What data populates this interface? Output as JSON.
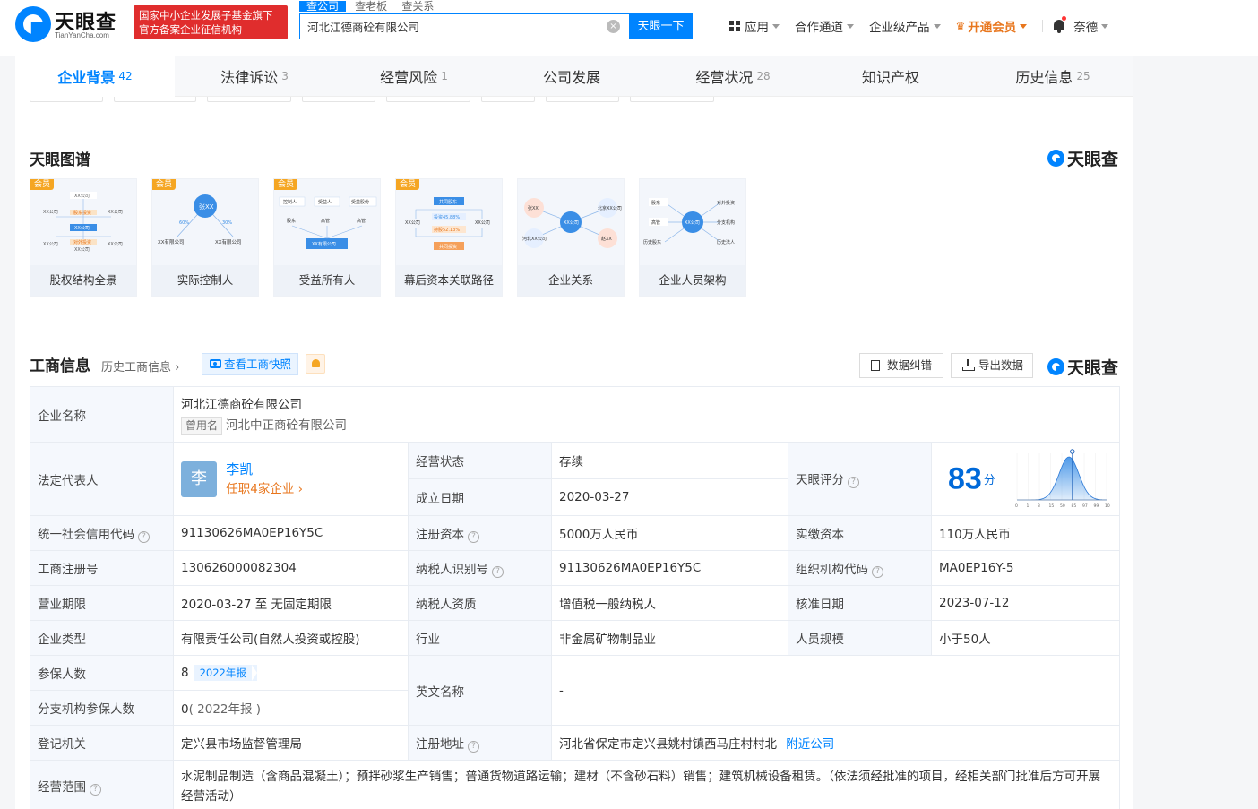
{
  "header": {
    "logo_text": "天眼查",
    "logo_sub": "TianYanCha.com",
    "gov_line1": "国家中小企业发展子基金旗下",
    "gov_line2": "官方备案企业征信机构",
    "search_tabs": [
      "查公司",
      "查老板",
      "查关系"
    ],
    "search_value": "河北江德商砼有限公司",
    "search_button": "天眼一下",
    "nav": {
      "apps": "应用",
      "partners": "合作通道",
      "enterprise": "企业级产品",
      "vip": "开通会员",
      "user": "奈德"
    }
  },
  "tabs": [
    {
      "label": "企业背景",
      "count": "42"
    },
    {
      "label": "法律诉讼",
      "count": "3"
    },
    {
      "label": "经营风险",
      "count": "1"
    },
    {
      "label": "公司发展",
      "count": ""
    },
    {
      "label": "经营状况",
      "count": "28"
    },
    {
      "label": "知识产权",
      "count": ""
    },
    {
      "label": "历史信息",
      "count": "25"
    }
  ],
  "graph_section": {
    "title": "天眼图谱",
    "brand": "天眼查",
    "vip_tag": "会员",
    "cards": [
      {
        "name": "股权结构全景",
        "vip": true,
        "thumb": {
          "t1": "XX公司",
          "t2": "XX公司",
          "t3": "XX公司",
          "t4": "XX公司",
          "t5": "XX公司",
          "t6": "XX公司",
          "t7": "XX公司",
          "e1": "对外投资",
          "e2": "股东投资"
        }
      },
      {
        "name": "实际控制人",
        "vip": true,
        "thumb": {
          "center": "张XX",
          "left": "XX有限公司",
          "right": "XX有限公司",
          "p1": "60%",
          "p2": "30%"
        }
      },
      {
        "name": "受益所有人",
        "vip": true,
        "thumb": {
          "a": "控制人",
          "b": "受益人",
          "c": "受益股份",
          "d": "股东",
          "e": "高管",
          "f": "高管",
          "g": "XX有限公司"
        }
      },
      {
        "name": "幕后资本关联路径",
        "vip": true,
        "thumb": {
          "top": "共同股东",
          "l": "XX公司",
          "r": "XX公司",
          "m1": "投资45.88%",
          "m2": "持股52.13%",
          "bottom": "共同投资"
        }
      },
      {
        "name": "企业关系",
        "vip": false,
        "thumb": {
          "a": "张XX",
          "b": "北京XX公司",
          "c": "XX公司",
          "d": "河北XX公司",
          "e": "赵XX"
        }
      },
      {
        "name": "企业人员架构",
        "vip": false,
        "thumb": {
          "a": "股东",
          "b": "高管",
          "c": "历史股东",
          "d": "XX公司",
          "e": "对外投资",
          "f": "分支机构",
          "g": "历史法人"
        }
      }
    ]
  },
  "biz": {
    "title": "工商信息",
    "history_link": "历史工商信息",
    "snapshot": "查看工商快照",
    "correct": "数据纠错",
    "export": "导出数据",
    "brand": "天眼查",
    "rows": {
      "company_name_label": "企业名称",
      "company_name": "河北江德商砼有限公司",
      "former_name_tag": "曾用名",
      "former_name": "河北中正商砼有限公司",
      "legal_rep_label": "法定代表人",
      "legal_rep_avatar": "李",
      "legal_rep": "李凯",
      "legal_rep_roles": "任职4家企业",
      "status_label": "经营状态",
      "status": "存续",
      "founded_label": "成立日期",
      "founded": "2020-03-27",
      "score_label": "天眼评分",
      "score": "83",
      "score_unit": "分",
      "credit_code_label": "统一社会信用代码",
      "credit_code": "91130626MA0EP16Y5C",
      "reg_capital_label": "注册资本",
      "reg_capital": "5000万人民币",
      "paid_capital_label": "实缴资本",
      "paid_capital": "110万人民币",
      "reg_no_label": "工商注册号",
      "reg_no": "130626000082304",
      "taxpayer_id_label": "纳税人识别号",
      "taxpayer_id": "91130626MA0EP16Y5C",
      "org_code_label": "组织机构代码",
      "org_code": "MA0EP16Y-5",
      "term_label": "营业期限",
      "term": "2020-03-27 至 无固定期限",
      "tax_qual_label": "纳税人资质",
      "tax_qual": "增值税一般纳税人",
      "approve_label": "核准日期",
      "approve": "2023-07-12",
      "type_label": "企业类型",
      "type": "有限责任公司(自然人投资或控股)",
      "industry_label": "行业",
      "industry": "非金属矿物制品业",
      "staff_label": "人员规模",
      "staff": "小于50人",
      "insured_label": "参保人数",
      "insured": "8",
      "insured_year": "2022年报",
      "english_label": "英文名称",
      "english": "-",
      "branch_insured_label": "分支机构参保人数",
      "branch_insured": "0",
      "branch_insured_year": "( 2022年报 )",
      "authority_label": "登记机关",
      "authority": "定兴县市场监督管理局",
      "address_label": "注册地址",
      "address": "河北省保定市定兴县姚村镇西马庄村村北",
      "nearby": "附近公司",
      "scope_label": "经营范围",
      "scope": "水泥制品制造（含商品混凝土）；预拌砂浆生产销售；普通货物道路运输；建材（不含砂石料）销售；建筑机械设备租赁。（依法须经批准的项目，经相关部门批准后方可开展经营活动）"
    },
    "score_chart": {
      "ticks": [
        "0",
        "1",
        "3",
        "15",
        "50",
        "85",
        "97",
        "99",
        "100"
      ],
      "score": 83
    }
  },
  "colors": {
    "brand": "#0084ff",
    "gov": "#e02d2d",
    "vip": "#e8761d",
    "status": "#17a05d"
  }
}
